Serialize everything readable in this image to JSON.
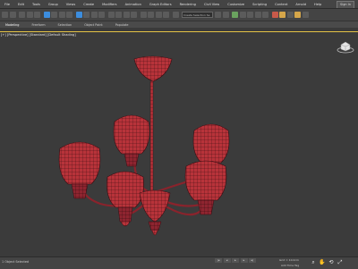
{
  "menu": {
    "items": [
      "File",
      "Edit",
      "Tools",
      "Group",
      "Views",
      "Create",
      "Modifiers",
      "Animation",
      "Graph Editors",
      "Rendering",
      "Civil View",
      "Customize",
      "Scripting",
      "Content",
      "Arnold",
      "Help"
    ],
    "signin_label": "Sign In"
  },
  "toolbar": {
    "selection_set_placeholder": "Create Selection Se"
  },
  "ribbon": {
    "tabs": [
      "Modeling",
      "Freeform",
      "Selection",
      "Object Paint",
      "Populate"
    ]
  },
  "viewport": {
    "label": "[+] [Perspective] [Standard] [Default Shading]"
  },
  "status": {
    "left_text": "1 Object Selected",
    "time": "0 / 100",
    "grid": "Grid = 10.0cm",
    "add_time_tag": "Add Time Tag"
  },
  "colors": {
    "mesh": "#b8333a",
    "wire": "#3a0d12",
    "viewport_border": "#e5c445"
  }
}
